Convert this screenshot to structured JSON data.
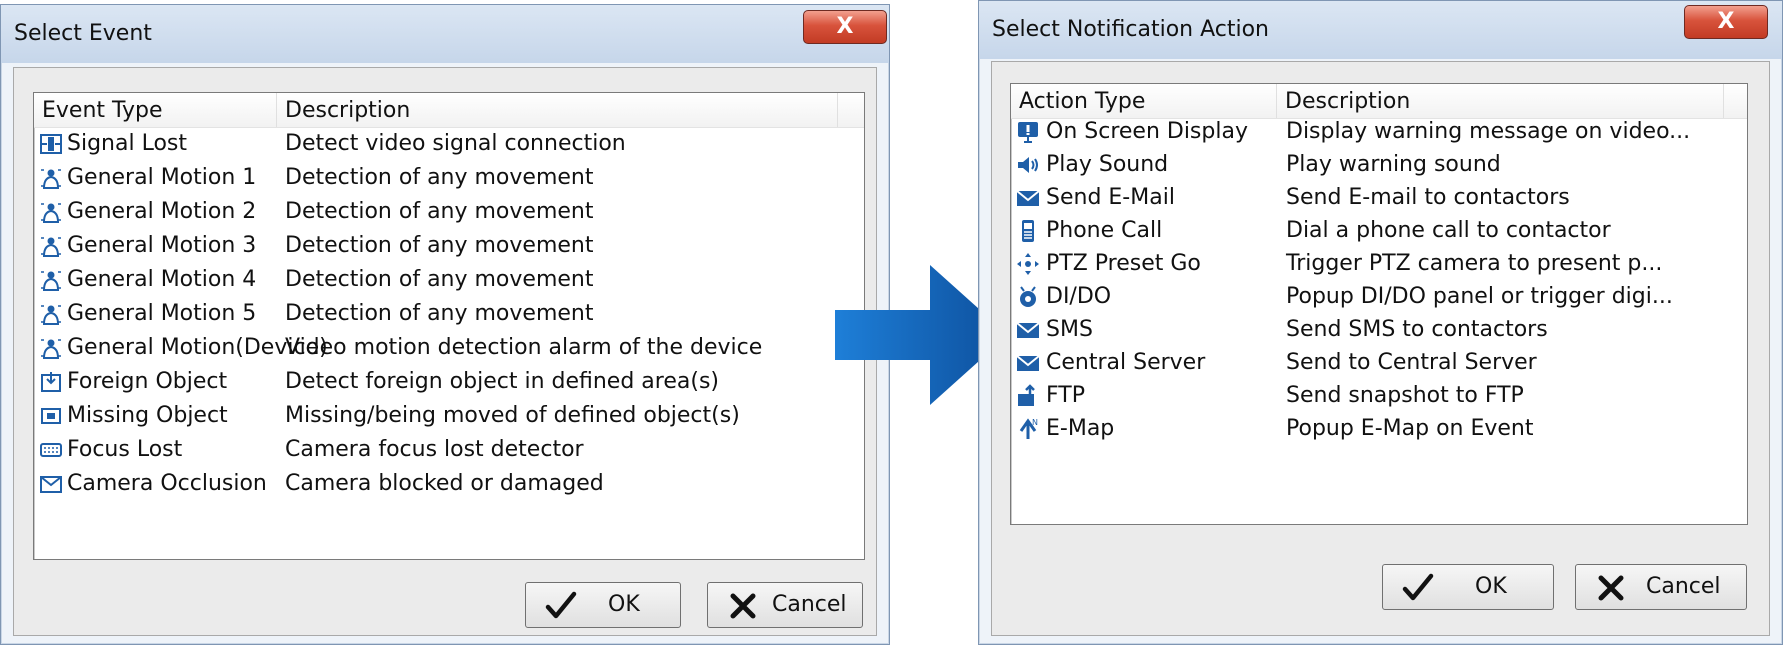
{
  "event_dialog": {
    "title": "Select Event",
    "close_label": "X",
    "columns": [
      "Event Type",
      "Description"
    ],
    "rows": [
      {
        "icon": "signal-lost-icon",
        "type": "Signal Lost",
        "description": "Detect video signal connection"
      },
      {
        "icon": "general-motion-icon",
        "type": "General Motion 1",
        "description": "Detection of any movement"
      },
      {
        "icon": "general-motion-icon",
        "type": "General Motion 2",
        "description": "Detection of any movement"
      },
      {
        "icon": "general-motion-icon",
        "type": "General Motion 3",
        "description": "Detection of any movement"
      },
      {
        "icon": "general-motion-icon",
        "type": "General Motion 4",
        "description": "Detection of any movement"
      },
      {
        "icon": "general-motion-icon",
        "type": "General Motion 5",
        "description": "Detection of any movement"
      },
      {
        "icon": "general-motion-icon",
        "type": "General Motion(Device)",
        "description": "Video motion detection alarm of the device"
      },
      {
        "icon": "foreign-object-icon",
        "type": "Foreign Object",
        "description": "Detect foreign object in defined area(s)"
      },
      {
        "icon": "missing-object-icon",
        "type": "Missing Object",
        "description": "Missing/being moved of defined object(s)"
      },
      {
        "icon": "focus-lost-icon",
        "type": "Focus Lost",
        "description": "Camera focus lost detector"
      },
      {
        "icon": "camera-occlusion-icon",
        "type": "Camera Occlusion",
        "description": "Camera blocked or damaged"
      }
    ],
    "ok_label": "OK",
    "cancel_label": "Cancel"
  },
  "action_dialog": {
    "title": "Select Notification Action",
    "close_label": "X",
    "columns": [
      "Action Type",
      "Description"
    ],
    "rows": [
      {
        "icon": "on-screen-display-icon",
        "type": "On Screen Display",
        "description": "Display warning message on video..."
      },
      {
        "icon": "play-sound-icon",
        "type": "Play Sound",
        "description": "Play warning sound"
      },
      {
        "icon": "envelope-icon",
        "type": "Send E-Mail",
        "description": "Send E-mail to contactors"
      },
      {
        "icon": "phone-icon",
        "type": "Phone Call",
        "description": "Dial a phone call to contactor"
      },
      {
        "icon": "ptz-icon",
        "type": "PTZ Preset Go",
        "description": "Trigger PTZ camera to present p..."
      },
      {
        "icon": "di-do-icon",
        "type": "DI/DO",
        "description": "Popup DI/DO panel or trigger digi..."
      },
      {
        "icon": "envelope-icon",
        "type": "SMS",
        "description": "Send SMS to contactors"
      },
      {
        "icon": "envelope-icon",
        "type": "Central Server",
        "description": "Send to Central Server"
      },
      {
        "icon": "ftp-icon",
        "type": "FTP",
        "description": "Send snapshot to FTP"
      },
      {
        "icon": "emap-icon",
        "type": "E-Map",
        "description": "Popup E-Map on Event"
      }
    ],
    "ok_label": "OK",
    "cancel_label": "Cancel"
  },
  "colors": {
    "arrow": "#1565c0",
    "close_button": "#c94a33",
    "icon_blue": "#1f5fa8"
  }
}
